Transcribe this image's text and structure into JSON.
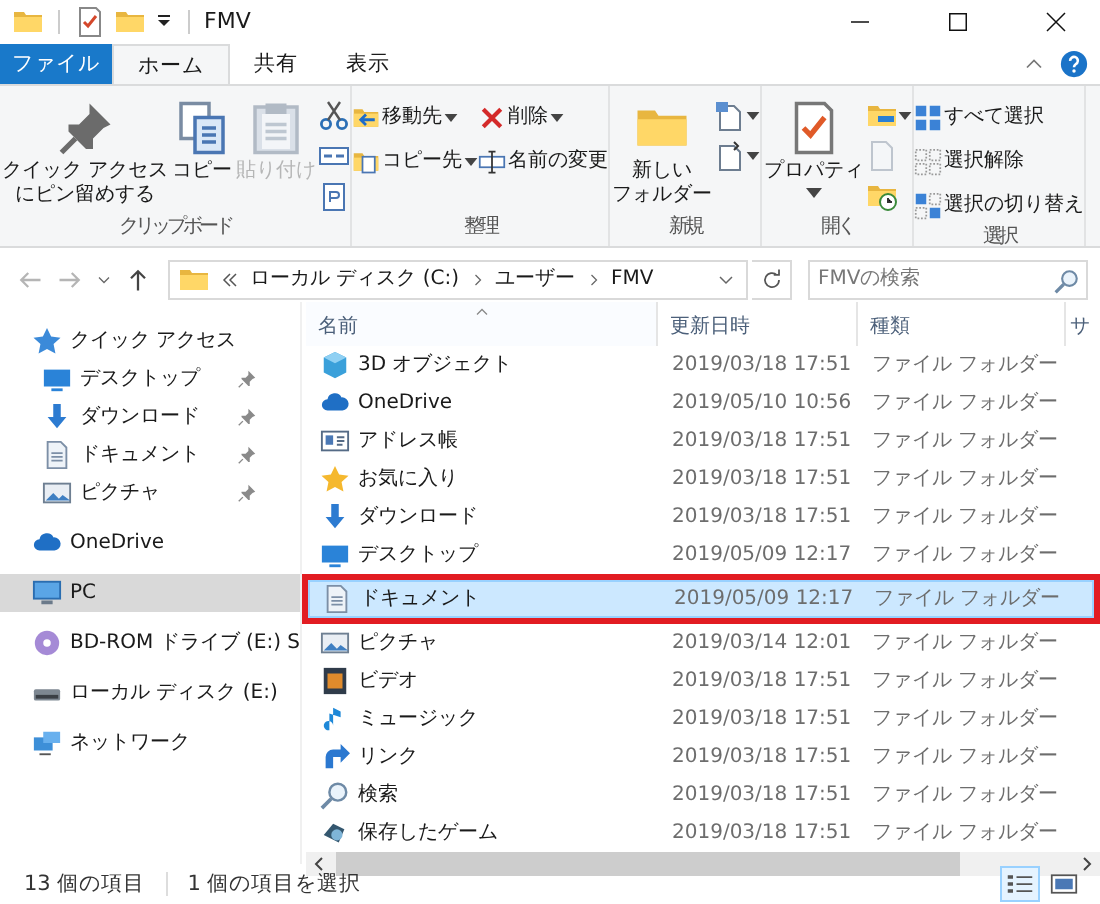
{
  "window": {
    "title": "FMV"
  },
  "ribbon_tabs": [
    {
      "label": "ファイル",
      "kind": "file",
      "selected": false
    },
    {
      "label": "ホーム",
      "kind": "tab",
      "selected": true
    },
    {
      "label": "共有",
      "kind": "tab",
      "selected": false
    },
    {
      "label": "表示",
      "kind": "tab",
      "selected": false
    }
  ],
  "ribbon_groups": [
    {
      "label": "クリップボード",
      "columns": [
        [
          {
            "kind": "large",
            "lines": [
              "クイック アクセス",
              "にピン留めする"
            ],
            "disabled": false,
            "dropdown": false
          }
        ],
        [
          {
            "kind": "large",
            "lines": [
              "コピー"
            ],
            "disabled": false,
            "dropdown": false
          }
        ],
        [
          {
            "kind": "large",
            "lines": [
              "貼り付け"
            ],
            "disabled": true,
            "dropdown": false
          }
        ],
        [
          {
            "kind": "icon",
            "disabled": false,
            "dropdown": false
          },
          {
            "kind": "icon",
            "disabled": false,
            "dropdown": false
          },
          {
            "kind": "icon",
            "disabled": false,
            "dropdown": false
          }
        ]
      ]
    },
    {
      "label": "整理",
      "columns": [
        [
          {
            "kind": "small",
            "label": "移動先",
            "disabled": false,
            "dropdown": true
          },
          {
            "kind": "small",
            "label": "コピー先",
            "disabled": false,
            "dropdown": true
          }
        ],
        [
          {
            "kind": "small",
            "label": "削除",
            "disabled": false,
            "dropdown": true
          },
          {
            "kind": "small",
            "label": "名前の変更",
            "disabled": false,
            "dropdown": false
          }
        ]
      ]
    },
    {
      "label": "新規",
      "columns": [
        [
          {
            "kind": "large",
            "lines": [
              "新しい",
              "フォルダー"
            ],
            "disabled": false,
            "dropdown": false
          }
        ],
        [
          {
            "kind": "icon",
            "disabled": false,
            "dropdown": true
          },
          {
            "kind": "icon",
            "disabled": false,
            "dropdown": true
          }
        ]
      ]
    },
    {
      "label": "開く",
      "columns": [
        [
          {
            "kind": "large",
            "lines": [
              "プロパティ"
            ],
            "disabled": false,
            "dropdown": true
          }
        ],
        [
          {
            "kind": "icon",
            "disabled": false,
            "dropdown": true
          },
          {
            "kind": "icon",
            "disabled": true,
            "dropdown": false
          },
          {
            "kind": "icon",
            "disabled": false,
            "dropdown": false
          }
        ]
      ]
    },
    {
      "label": "選択",
      "columns": [
        [
          {
            "kind": "small",
            "label": "すべて選択",
            "disabled": false,
            "dropdown": false
          },
          {
            "kind": "small",
            "label": "選択解除",
            "disabled": false,
            "dropdown": false
          },
          {
            "kind": "small",
            "label": "選択の切り替え",
            "disabled": false,
            "dropdown": false
          }
        ]
      ]
    }
  ],
  "address": {
    "segments": [
      "ローカル ディスク (C:)",
      "ユーザー",
      "FMV"
    ]
  },
  "search": {
    "placeholder": "FMVの検索"
  },
  "navigation": [
    {
      "label": "クイック アクセス",
      "selected": false,
      "children": [
        {
          "label": "デスクトップ",
          "pinned": true,
          "selected": false
        },
        {
          "label": "ダウンロード",
          "pinned": true,
          "selected": false
        },
        {
          "label": "ドキュメント",
          "pinned": true,
          "selected": false
        },
        {
          "label": "ピクチャ",
          "pinned": true,
          "selected": false
        }
      ]
    },
    {
      "label": "OneDrive",
      "selected": false
    },
    {
      "label": "PC",
      "selected": true
    },
    {
      "label": "BD-ROM ドライブ (E:) S",
      "selected": false
    },
    {
      "label": "ローカル ディスク (E:)",
      "selected": false
    },
    {
      "label": "ネットワーク",
      "selected": false
    }
  ],
  "table": {
    "columns": [
      {
        "label": "名前",
        "sorted": true
      },
      {
        "label": "更新日時",
        "sorted": false
      },
      {
        "label": "種類",
        "sorted": false
      },
      {
        "label": "サ",
        "sorted": false
      }
    ],
    "rows": [
      {
        "name": "3D オブジェクト",
        "modified": "2019/03/18 17:51",
        "type": "ファイル フォルダー",
        "selected": false,
        "highlighted": false
      },
      {
        "name": "OneDrive",
        "modified": "2019/05/10 10:56",
        "type": "ファイル フォルダー",
        "selected": false,
        "highlighted": false
      },
      {
        "name": "アドレス帳",
        "modified": "2019/03/18 17:51",
        "type": "ファイル フォルダー",
        "selected": false,
        "highlighted": false
      },
      {
        "name": "お気に入り",
        "modified": "2019/03/18 17:51",
        "type": "ファイル フォルダー",
        "selected": false,
        "highlighted": false
      },
      {
        "name": "ダウンロード",
        "modified": "2019/03/18 17:51",
        "type": "ファイル フォルダー",
        "selected": false,
        "highlighted": false
      },
      {
        "name": "デスクトップ",
        "modified": "2019/05/09 12:17",
        "type": "ファイル フォルダー",
        "selected": false,
        "highlighted": false
      },
      {
        "name": "ドキュメント",
        "modified": "2019/05/09 12:17",
        "type": "ファイル フォルダー",
        "selected": true,
        "highlighted": true
      },
      {
        "name": "ピクチャ",
        "modified": "2019/03/14 12:01",
        "type": "ファイル フォルダー",
        "selected": false,
        "highlighted": false
      },
      {
        "name": "ビデオ",
        "modified": "2019/03/18 17:51",
        "type": "ファイル フォルダー",
        "selected": false,
        "highlighted": false
      },
      {
        "name": "ミュージック",
        "modified": "2019/03/18 17:51",
        "type": "ファイル フォルダー",
        "selected": false,
        "highlighted": false
      },
      {
        "name": "リンク",
        "modified": "2019/03/18 17:51",
        "type": "ファイル フォルダー",
        "selected": false,
        "highlighted": false
      },
      {
        "name": "検索",
        "modified": "2019/03/18 17:51",
        "type": "ファイル フォルダー",
        "selected": false,
        "highlighted": false
      },
      {
        "name": "保存したゲーム",
        "modified": "2019/03/18 17:51",
        "type": "ファイル フォルダー",
        "selected": false,
        "highlighted": false
      }
    ]
  },
  "status_bar": {
    "item_count": "13 個の項目",
    "selection": "1 個の項目を選択",
    "views": [
      {
        "selected": true
      },
      {
        "selected": false
      }
    ]
  }
}
